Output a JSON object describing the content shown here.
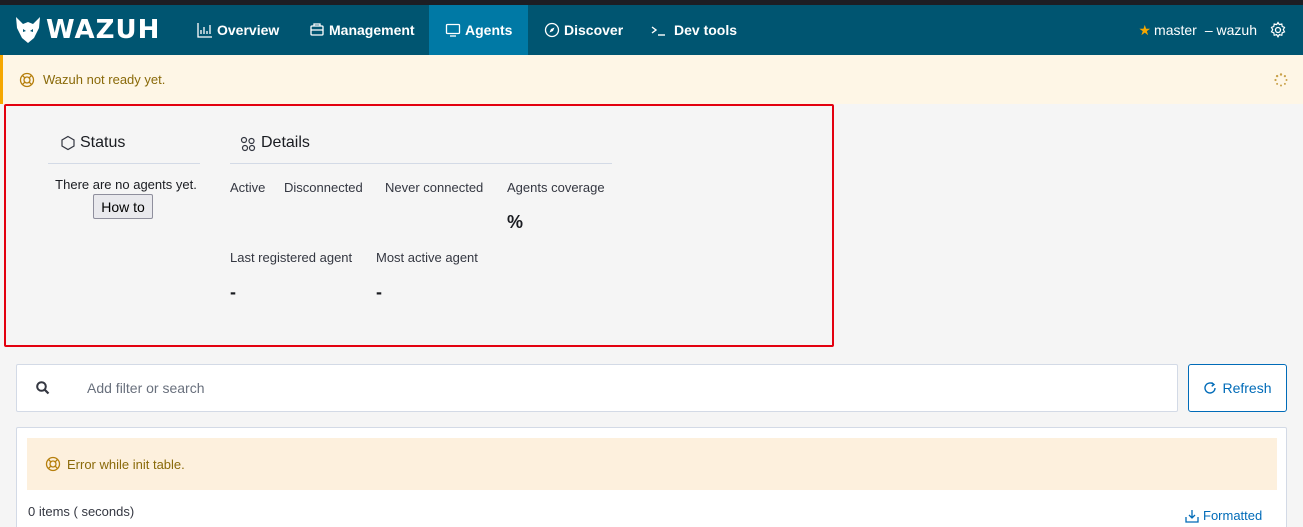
{
  "navbar": {
    "brand": "WAZUH",
    "tabs": [
      {
        "label": "Overview",
        "icon": "chart-icon"
      },
      {
        "label": "Management",
        "icon": "management-icon"
      },
      {
        "label": "Agents",
        "icon": "monitor-icon",
        "active": true
      },
      {
        "label": "Discover",
        "icon": "compass-icon"
      },
      {
        "label": "Dev tools",
        "icon": "console-icon"
      }
    ],
    "api_label": "master",
    "index_label": "– wazuh",
    "accent_color": "#005571",
    "active_color": "#0079a5"
  },
  "notice": {
    "message": "Wazuh not ready yet.",
    "icon": "lifebuoy-icon",
    "color": "#f5a700"
  },
  "status": {
    "title": "Status",
    "empty_message": "There are no agents yet.",
    "howto_label": "How to"
  },
  "details": {
    "title": "Details",
    "stats": {
      "active": "Active",
      "disconnected": "Disconnected",
      "never_connected": "Never connected",
      "coverage": "Agents coverage",
      "coverage_value": "%",
      "last_registered": "Last registered agent",
      "last_registered_value": "-",
      "most_active": "Most active agent",
      "most_active_value": "-"
    }
  },
  "search": {
    "placeholder": "Add filter or search"
  },
  "refresh": {
    "label": "Refresh"
  },
  "table": {
    "error_message": "Error while init table.",
    "items_count": "0 items ( seconds)",
    "formatted_label": "Formatted"
  }
}
